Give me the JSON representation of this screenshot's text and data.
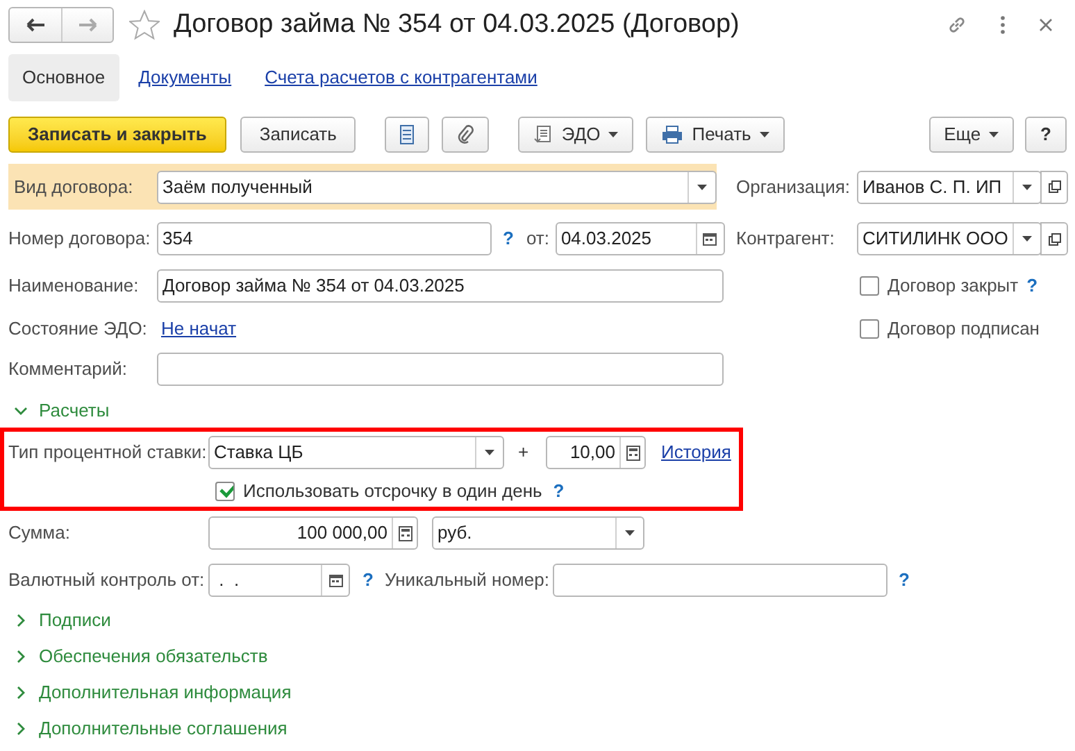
{
  "window": {
    "title": "Договор займа № 354 от 04.03.2025 (Договор)"
  },
  "tabs": [
    {
      "label": "Основное",
      "selected": true
    },
    {
      "label": "Документы",
      "selected": false
    },
    {
      "label": "Счета расчетов с контрагентами",
      "selected": false
    }
  ],
  "toolbar": {
    "save_close": "Записать и закрыть",
    "save": "Записать",
    "edo": "ЭДО",
    "print": "Печать",
    "more": "Еще",
    "help": "?"
  },
  "contract_type": {
    "label": "Вид договора:",
    "value": "Заём полученный"
  },
  "organization": {
    "label": "Организация:",
    "value": "Иванов С. П. ИП"
  },
  "number": {
    "label": "Номер договора:",
    "value": "354",
    "help": "?"
  },
  "date": {
    "label": "от:",
    "value": "04.03.2025"
  },
  "counterparty": {
    "label": "Контрагент:",
    "value": "СИТИЛИНК ООО"
  },
  "name": {
    "label": "Наименование:",
    "value": "Договор займа № 354 от 04.03.2025"
  },
  "closed": {
    "label": "Договор закрыт",
    "checked": false,
    "help": "?"
  },
  "edo_state": {
    "label": "Состояние ЭДО:",
    "link": "Не начат"
  },
  "signed": {
    "label": "Договор подписан",
    "checked": false
  },
  "comment": {
    "label": "Комментарий:"
  },
  "settlements": {
    "label": "Расчеты",
    "expanded": true,
    "rate_type": {
      "label": "Тип процентной ставки:",
      "value": "Ставка ЦБ"
    },
    "plus": "+",
    "rate": "10,00",
    "history": "История",
    "deferral": {
      "label": "Использовать отсрочку в один день",
      "checked": true,
      "help": "?"
    }
  },
  "amount": {
    "label": "Сумма:",
    "value": "100 000,00",
    "currency": "руб."
  },
  "currency_control": {
    "label": "Валютный контроль от:",
    "value": " .  .",
    "help": "?"
  },
  "unique_number": {
    "label": "Уникальный номер:",
    "help": "?"
  },
  "groups": [
    {
      "label": "Подписи",
      "expanded": false
    },
    {
      "label": "Обеспечения обязательств",
      "expanded": false
    },
    {
      "label": "Дополнительная информация",
      "expanded": false
    },
    {
      "label": "Дополнительные соглашения",
      "expanded": false
    }
  ]
}
